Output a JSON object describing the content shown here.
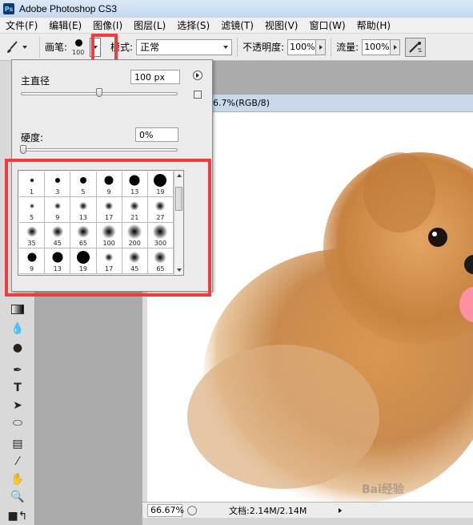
{
  "titlebar": {
    "app_icon": "Ps",
    "title": "Adobe Photoshop CS3"
  },
  "menu": [
    "文件(F)",
    "编辑(E)",
    "图像(I)",
    "图层(L)",
    "选择(S)",
    "滤镜(T)",
    "视图(V)",
    "窗口(W)",
    "帮助(H)"
  ],
  "options": {
    "brush_label": "画笔:",
    "brush_size": "100",
    "mode_label": "模式:",
    "mode_value": "正常",
    "opacity_label": "不透明度:",
    "opacity_value": "100%",
    "flow_label": "流量:",
    "flow_value": "100%"
  },
  "brush_panel": {
    "diameter_label": "主直径",
    "diameter_value": "100 px",
    "diameter_level": 0.5,
    "hardness_label": "硬度:",
    "hardness_value": "0%",
    "hardness_level": 0.0,
    "presets": [
      {
        "size": "1",
        "hard": true
      },
      {
        "size": "3",
        "hard": true
      },
      {
        "size": "5",
        "hard": true
      },
      {
        "size": "9",
        "hard": true
      },
      {
        "size": "13",
        "hard": true
      },
      {
        "size": "19",
        "hard": true
      },
      {
        "size": "5",
        "hard": false
      },
      {
        "size": "9",
        "hard": false
      },
      {
        "size": "13",
        "hard": false
      },
      {
        "size": "17",
        "hard": false
      },
      {
        "size": "21",
        "hard": false
      },
      {
        "size": "27",
        "hard": false
      },
      {
        "size": "35",
        "hard": false
      },
      {
        "size": "45",
        "hard": false
      },
      {
        "size": "65",
        "hard": false
      },
      {
        "size": "100",
        "hard": false
      },
      {
        "size": "200",
        "hard": false
      },
      {
        "size": "300",
        "hard": false
      },
      {
        "size": "9",
        "hard": true
      },
      {
        "size": "13",
        "hard": true
      },
      {
        "size": "19",
        "hard": true
      },
      {
        "size": "17",
        "hard": false
      },
      {
        "size": "45",
        "hard": false
      },
      {
        "size": "65",
        "hard": false
      }
    ]
  },
  "document": {
    "title_fragment": "6.7%(RGB/8)",
    "zoom": "66.67%",
    "doc_info": "文档:2.14M/2.14M"
  },
  "watermark": "Bai经验",
  "colors": {
    "highlight": "#ee3d3d",
    "dog_fur": "#c98a4e"
  }
}
